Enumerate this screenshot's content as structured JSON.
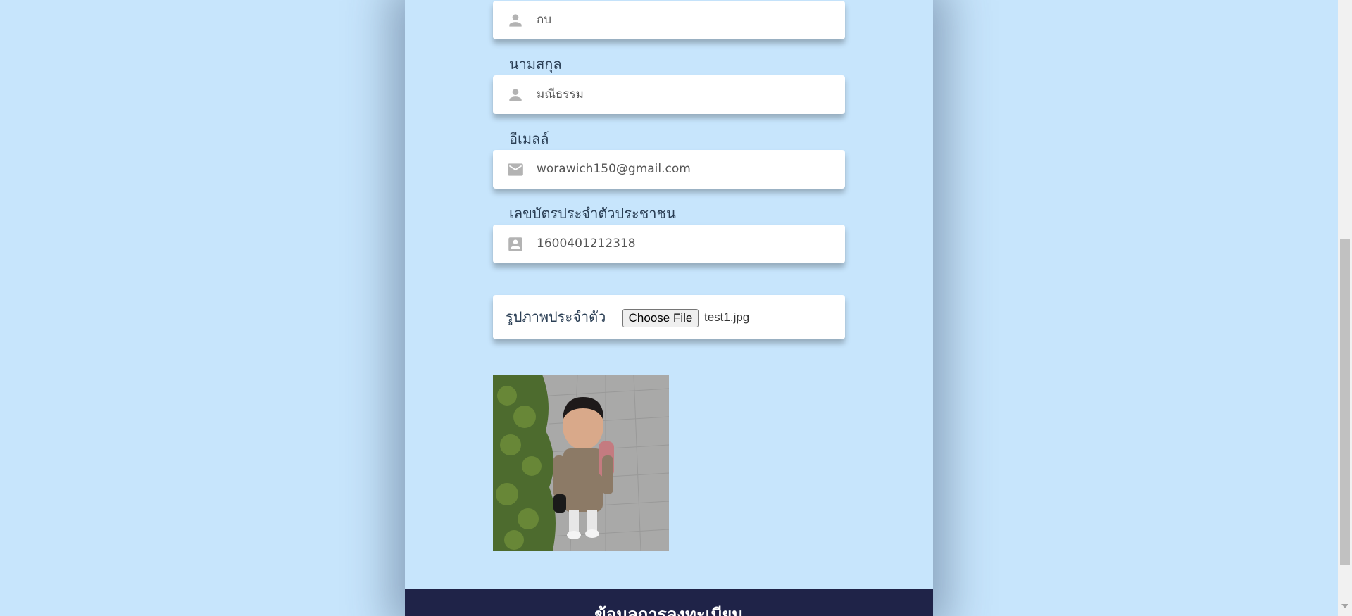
{
  "form": {
    "first_name_value": "กบ",
    "last_name_label": "นามสกุล",
    "last_name_value": "มณีธรรม",
    "email_label": "อีเมลล์",
    "email_value": "worawich150@gmail.com",
    "id_label": "เลขบัตรประจำตัวประชาชน",
    "id_value": "1600401212318",
    "photo_label": "รูปภาพประจำตัว",
    "choose_file_label": "Choose File",
    "chosen_file_name": "test1.jpg"
  },
  "footer": {
    "text": "ข้อมูลการลงทะเบียน"
  },
  "icons": {
    "first_name": "person-icon",
    "last_name": "person-icon",
    "email": "mail-icon",
    "id": "contact-card-icon"
  },
  "colors": {
    "background": "#c7e5fc",
    "footer": "#1f2348",
    "icon": "#b3b3b3"
  }
}
